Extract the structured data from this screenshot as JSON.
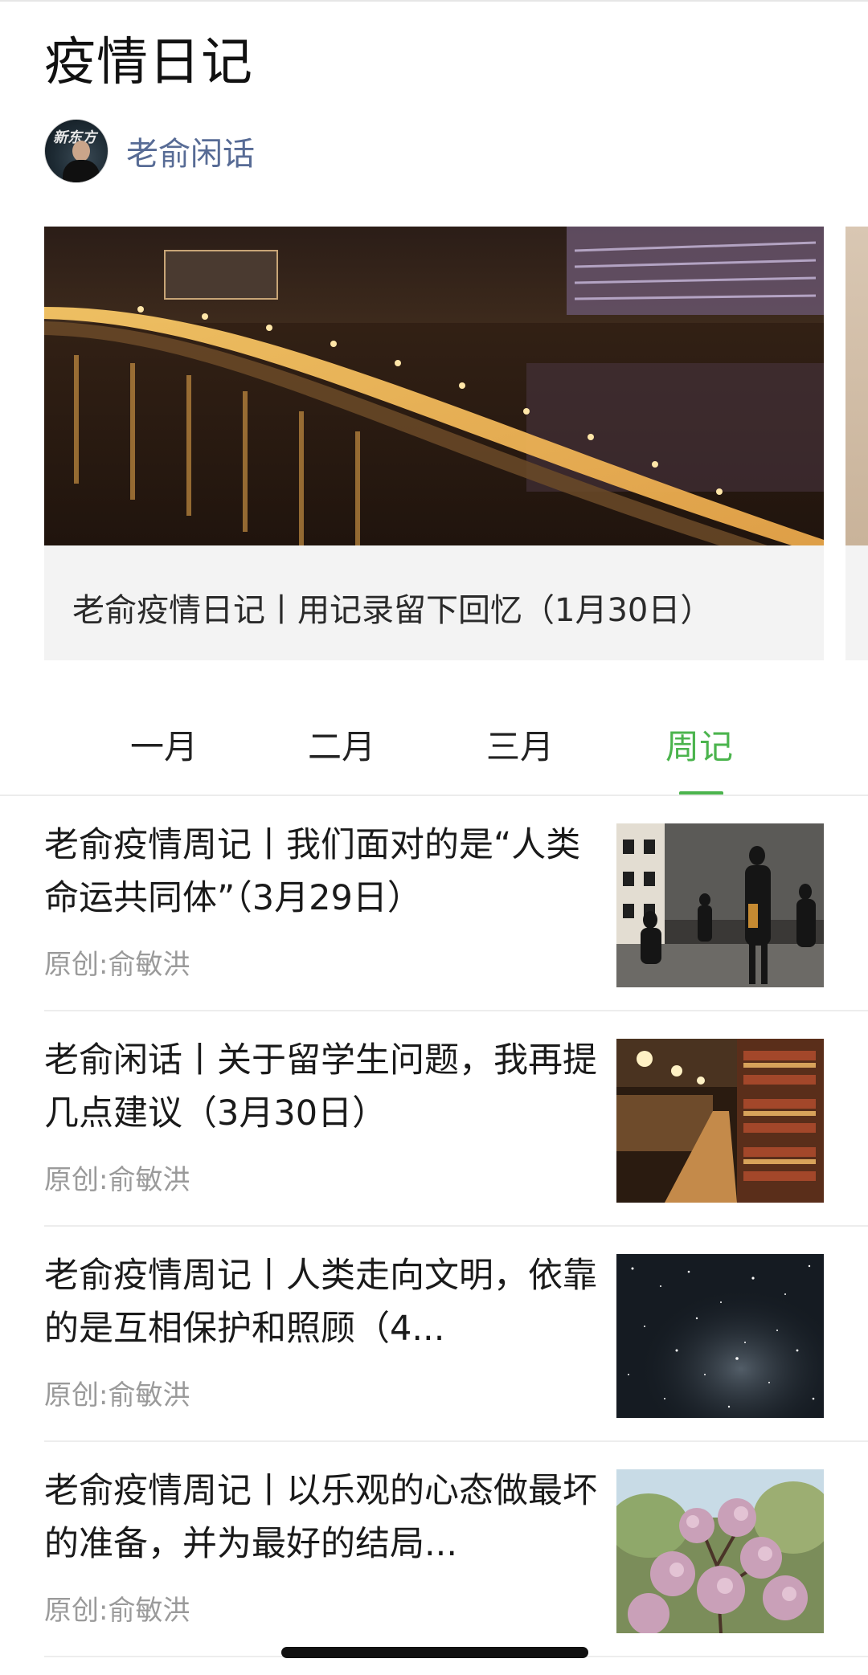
{
  "page": {
    "title": "疫情日记"
  },
  "author": {
    "name": "老俞闲话",
    "avatar_text": "新东方"
  },
  "banner": {
    "caption": "老俞疫情日记丨用记录留下回忆（1月30日）"
  },
  "tabs": [
    {
      "label": "一月",
      "active": false
    },
    {
      "label": "二月",
      "active": false
    },
    {
      "label": "三月",
      "active": false
    },
    {
      "label": "周记",
      "active": true
    }
  ],
  "articles": [
    {
      "title": "老俞疫情周记丨我们面对的是“人类命运共同体”（3月29日）",
      "meta": "原创:俞敏洪",
      "thumb": "street-people"
    },
    {
      "title": "老俞闲话丨关于留学生问题，我再提几点建议（3月30日）",
      "meta": "原创:俞敏洪",
      "thumb": "library"
    },
    {
      "title": "老俞疫情周记丨人类走向文明，依靠的是互相保护和照顾（4...",
      "meta": "原创:俞敏洪",
      "thumb": "starry-sky"
    },
    {
      "title": "老俞疫情周记丨以乐观的心态做最坏的准备，并为最好的结局...",
      "meta": "原创:俞敏洪",
      "thumb": "blossom-tree"
    }
  ],
  "colors": {
    "accent": "#4bb44d",
    "author_link": "#576b95",
    "meta": "#9a9a9a"
  }
}
